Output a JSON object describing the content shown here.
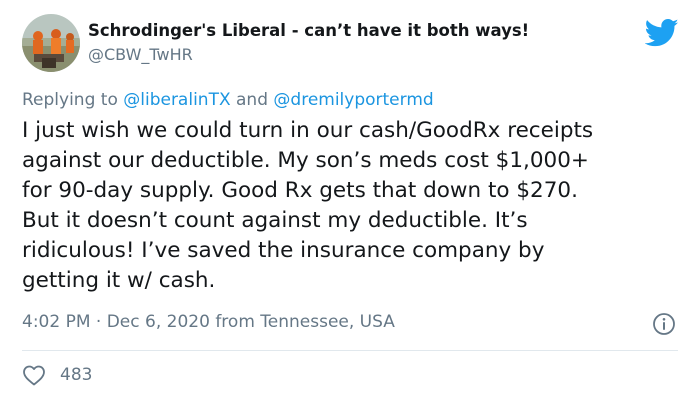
{
  "author": {
    "display_name": "Schrodinger's Liberal - can’t have it both ways!",
    "handle": "@CBW_TwHR"
  },
  "reply": {
    "prefix": "Replying to",
    "mention_1": "@liberalinTX",
    "joiner": "and",
    "mention_2": "@dremilyportermd"
  },
  "tweet": {
    "lines": [
      "I just wish we could turn in our cash/GoodRx receipts",
      "against our deductible. My son’s meds cost $1,000+",
      "for 90-day supply. Good Rx gets that down to $270.",
      "But it doesn’t count against my deductible. It’s",
      "ridiculous! I’ve saved the insurance company by",
      "getting it w/ cash."
    ]
  },
  "meta": {
    "time": "4:02 PM",
    "separator": "·",
    "date": "Dec 6, 2020",
    "location": "from Tennessee, USA"
  },
  "actions": {
    "like_count": "483"
  },
  "icons": {
    "brand": "twitter-bird-icon",
    "info": "info-icon",
    "like": "heart-icon"
  },
  "colors": {
    "brand_blue": "#1da1f2",
    "link_blue": "#1b95e0",
    "text_primary": "#14171a",
    "text_secondary": "#657786",
    "divider": "#e1e8ed"
  }
}
